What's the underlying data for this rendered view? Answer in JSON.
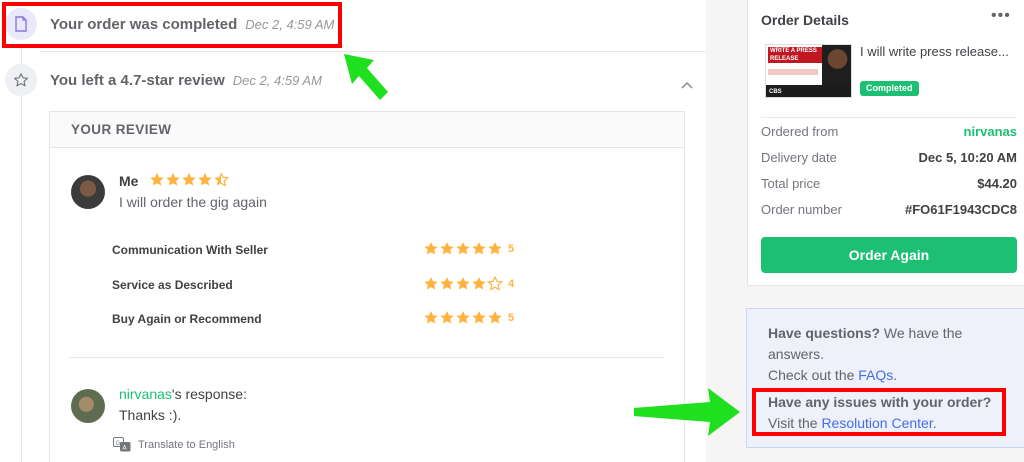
{
  "timeline": {
    "completed": {
      "title": "Your order was completed",
      "time": "Dec 2, 4:59 AM",
      "icon": "document-icon"
    },
    "review": {
      "title": "You left a 4.7-star review",
      "time": "Dec 2, 4:59 AM",
      "icon": "star-outline-icon",
      "collapse_icon": "chevron-up-icon"
    }
  },
  "review": {
    "header": "YOUR REVIEW",
    "author": "Me",
    "overall_rating": 4.7,
    "text": "I will order the gig again",
    "criteria": [
      {
        "label": "Communication With Seller",
        "score": "5",
        "rating": 5
      },
      {
        "label": "Service as Described",
        "score": "4",
        "rating": 4
      },
      {
        "label": "Buy Again or Recommend",
        "score": "5",
        "rating": 5
      }
    ],
    "response": {
      "seller": "nirvanas",
      "suffix": "'s response:",
      "text": "Thanks :).",
      "translate_label": "Translate to English"
    }
  },
  "order_details": {
    "title": "Order Details",
    "gig_title": "I will write press release...",
    "thumbnail": {
      "headline": "WRITE A PRESS RELEASE",
      "band": "CBS"
    },
    "status": "Completed",
    "rows": [
      {
        "key": "Ordered from",
        "value": "nirvanas",
        "accent": "#1dbf73"
      },
      {
        "key": "Delivery date",
        "value": "Dec 5, 10:20 AM"
      },
      {
        "key": "Total price",
        "value": "$44.20"
      },
      {
        "key": "Order number",
        "value": "#FO61F1943CDC8"
      }
    ],
    "button_label": "Order Again"
  },
  "help": {
    "q_bold": "Have questions?",
    "q_rest": " We have the",
    "q_line2": "answers.",
    "check_prefix": "Check out the ",
    "faq_link": "FAQs",
    "check_suffix": ".",
    "issues_bold": "Have any issues with your order?",
    "visit_prefix": "Visit the ",
    "resolution_link": "Resolution Center",
    "visit_suffix": "."
  },
  "colors": {
    "brand_green": "#1dbf73",
    "star": "#ffb33e",
    "link": "#446ee7",
    "highlight": "#ff0000",
    "arrow": "#1fe01f"
  }
}
